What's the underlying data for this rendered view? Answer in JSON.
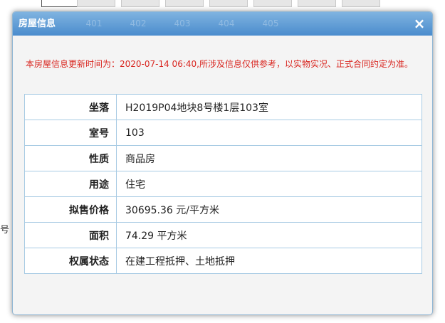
{
  "background": {
    "tab_cells": [
      "",
      "",
      "",
      "",
      "",
      "",
      "",
      "",
      ""
    ],
    "edge_chars": [
      "号"
    ]
  },
  "dialog": {
    "title": "房屋信息",
    "ghost_numbers": [
      "401",
      "402",
      "403",
      "404",
      "405"
    ],
    "close_icon": "×",
    "notice": "本房屋信息更新时间为：2020-07-14 06:40,所涉及信息仅供参考，以实物实况、正式合同约定为准。",
    "rows": [
      {
        "label": "坐落",
        "value": "H2019P04地块8号楼1层103室"
      },
      {
        "label": "室号",
        "value": "103"
      },
      {
        "label": "性质",
        "value": "商品房"
      },
      {
        "label": "用途",
        "value": "住宅"
      },
      {
        "label": "拟售价格",
        "value": "30695.36 元/平方米"
      },
      {
        "label": "面积",
        "value": "74.29 平方米"
      },
      {
        "label": "权属状态",
        "value": "在建工程抵押、土地抵押"
      }
    ]
  },
  "colors": {
    "titlebar": "#4a8ccd",
    "notice": "#d9251f",
    "table_border": "#a8cbe4"
  }
}
